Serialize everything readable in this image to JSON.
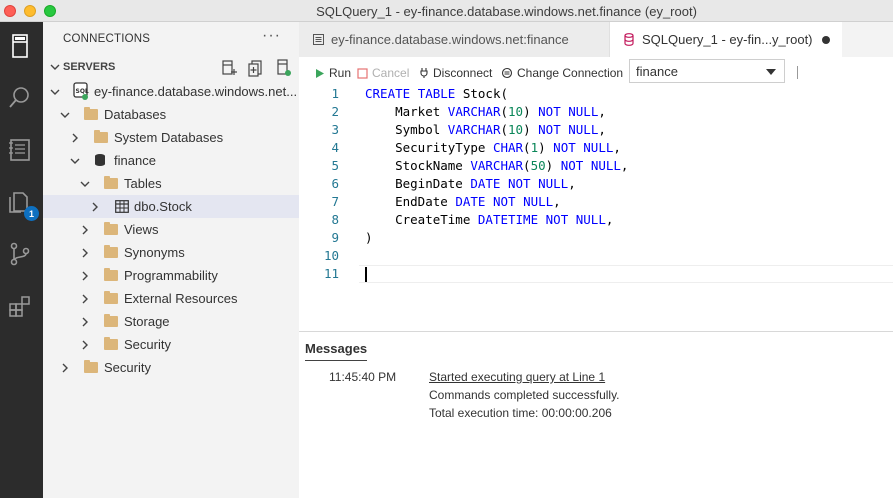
{
  "window": {
    "title": "SQLQuery_1 - ey-finance.database.windows.net.finance (ey_root)"
  },
  "activity_bar": {
    "badge_count": "1"
  },
  "sidebar": {
    "header": "CONNECTIONS",
    "more": "···",
    "servers_label": "SERVERS",
    "tree": {
      "server": "ey-finance.database.windows.net...",
      "databases": "Databases",
      "system_databases": "System Databases",
      "finance": "finance",
      "tables": "Tables",
      "dbo_stock": "dbo.Stock",
      "views": "Views",
      "synonyms": "Synonyms",
      "programmability": "Programmability",
      "external_resources": "External Resources",
      "storage": "Storage",
      "security_inner": "Security",
      "security_outer": "Security"
    }
  },
  "tabs": [
    {
      "label": "ey-finance.database.windows.net:finance"
    },
    {
      "label": "SQLQuery_1 - ey-fin...y_root)"
    }
  ],
  "toolbar": {
    "run": "Run",
    "cancel": "Cancel",
    "disconnect": "Disconnect",
    "change_connection": "Change Connection",
    "database": "finance"
  },
  "editor": {
    "line_numbers": [
      "1",
      "2",
      "3",
      "4",
      "5",
      "6",
      "7",
      "8",
      "9",
      "10",
      "11"
    ]
  },
  "messages": {
    "title": "Messages",
    "time": "11:45:40 PM",
    "lines": [
      "Started executing query at Line 1",
      "Commands completed successfully.",
      "Total execution time: 00:00:00.206"
    ]
  },
  "colors": {
    "activity_bar": "#2c2c2c",
    "sidebar": "#f3f3f3",
    "keyword": "#0000ff",
    "number": "#098658",
    "line_number": "#237893",
    "badge": "#0e70c0"
  }
}
